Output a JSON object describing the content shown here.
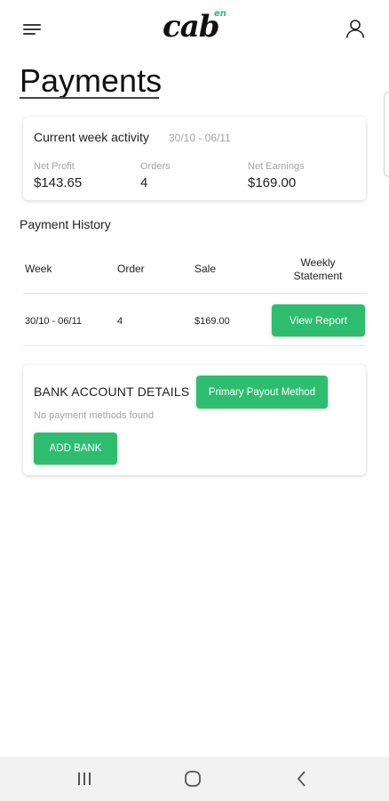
{
  "header": {
    "logo_main": "cab",
    "logo_sup": "en",
    "menu_icon": "hamburger-menu-icon",
    "profile_icon": "user-icon"
  },
  "page": {
    "title": "Payments"
  },
  "current_week": {
    "title": "Current week activity",
    "range": "30/10 - 06/11",
    "stats": [
      {
        "label": "Net Profit",
        "value": "$143.65"
      },
      {
        "label": "Orders",
        "value": "4"
      },
      {
        "label": "Net Earnings",
        "value": "$169.00"
      }
    ]
  },
  "payment_history": {
    "title": "Payment History",
    "columns": [
      "Week",
      "Order",
      "Sale",
      "Weekly Statement"
    ],
    "rows": [
      {
        "week": "30/10 - 06/11",
        "order": "4",
        "sale": "$169.00",
        "action": "View Report"
      }
    ]
  },
  "bank": {
    "title": "BANK ACCOUNT DETAILS",
    "primary_button": "Primary Payout Method",
    "empty_text": "No payment methods found",
    "add_button": "ADD BANK"
  },
  "colors": {
    "accent": "#2ebd6f",
    "muted_text": "#a4a4a4",
    "navbar_bg": "#f2f2f2"
  },
  "system_nav": {
    "icons": [
      "recent-apps-icon",
      "home-icon",
      "back-icon"
    ]
  }
}
